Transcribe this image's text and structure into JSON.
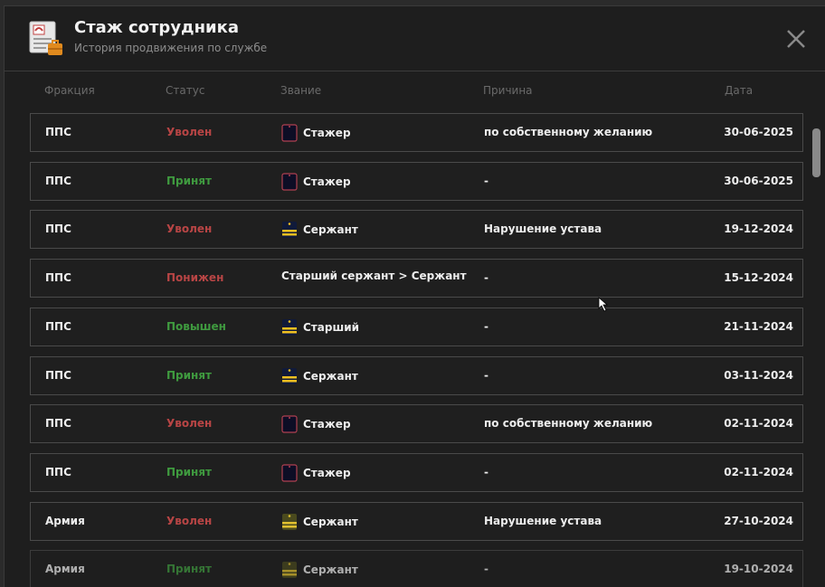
{
  "header": {
    "title": "Стаж сотрудника",
    "subtitle": "История продвижения по службе"
  },
  "columns": {
    "faction": "Фракция",
    "status": "Статус",
    "rank": "Звание",
    "reason": "Причина",
    "date": "Дата"
  },
  "rows": [
    {
      "faction": "ППС",
      "status": "Уволен",
      "status_color": "red",
      "rank": "Стажер",
      "rank_icon": "trainee-shoulder-icon",
      "reason": "по собственному желанию",
      "date": "30-06-2025"
    },
    {
      "faction": "ППС",
      "status": "Принят",
      "status_color": "green",
      "rank": "Стажер",
      "rank_icon": "trainee-shoulder-icon",
      "reason": "-",
      "date": "30-06-2025"
    },
    {
      "faction": "ППС",
      "status": "Уволен",
      "status_color": "red",
      "rank": "Сержант",
      "rank_icon": "sergeant-police-icon",
      "reason": "Нарушение устава",
      "date": "19-12-2024"
    },
    {
      "faction": "ППС",
      "status": "Понижен",
      "status_color": "red",
      "rank": "Старший сержант > Сержант",
      "rank_icon": "",
      "reason": "-",
      "date": "15-12-2024"
    },
    {
      "faction": "ППС",
      "status": "Повышен",
      "status_color": "green",
      "rank": "Старший",
      "rank_icon": "sergeant-police-icon",
      "reason": "-",
      "date": "21-11-2024"
    },
    {
      "faction": "ППС",
      "status": "Принят",
      "status_color": "green",
      "rank": "Сержант",
      "rank_icon": "sergeant-police-icon",
      "reason": "-",
      "date": "03-11-2024"
    },
    {
      "faction": "ППС",
      "status": "Уволен",
      "status_color": "red",
      "rank": "Стажер",
      "rank_icon": "trainee-shoulder-icon",
      "reason": "по собственному желанию",
      "date": "02-11-2024"
    },
    {
      "faction": "ППС",
      "status": "Принят",
      "status_color": "green",
      "rank": "Стажер",
      "rank_icon": "trainee-shoulder-icon",
      "reason": "-",
      "date": "02-11-2024"
    },
    {
      "faction": "Армия",
      "status": "Уволен",
      "status_color": "red",
      "rank": "Сержант",
      "rank_icon": "sergeant-army-icon",
      "reason": "Нарушение устава",
      "date": "27-10-2024"
    },
    {
      "faction": "Армия",
      "status": "Принят",
      "status_color": "green",
      "rank": "Сержант",
      "rank_icon": "sergeant-army-icon",
      "reason": "-",
      "date": "19-10-2024"
    }
  ],
  "colors": {
    "background": "#1e1e1e",
    "status_red": "#b84545",
    "status_green": "#3f9a3f",
    "gold": "#f0c020"
  }
}
